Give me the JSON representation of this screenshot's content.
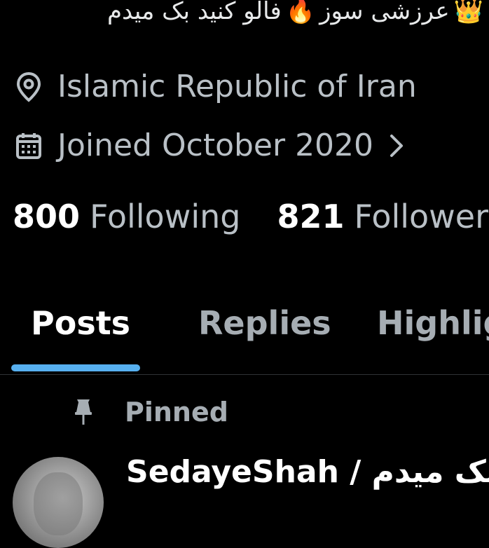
{
  "profile": {
    "bio_text_main": "عرزشی سوز",
    "bio_text_follow": "فالو کنید بک میدم",
    "location": "Islamic Republic of Iran",
    "joined": "Joined October 2020",
    "following_count": "800",
    "following_label": "Following",
    "followers_count": "821",
    "followers_label": "Followers"
  },
  "icons": {
    "crown": "crown-icon",
    "fire": "fire-icon",
    "location": "location-pin-icon",
    "calendar": "calendar-icon",
    "chevron": "chevron-right-icon",
    "pin": "pin-icon"
  },
  "tabs": [
    {
      "label": "Posts",
      "active": true
    },
    {
      "label": "Replies",
      "active": false
    },
    {
      "label": "Highlig",
      "active": false
    }
  ],
  "pinned_post": {
    "pinned_label": "Pinned",
    "author": "SedayeShah / بک میدم"
  },
  "colors": {
    "background": "#000000",
    "accent": "#57b0f0",
    "secondary_text": "#b9c0c6",
    "primary_text": "#ffffff"
  }
}
